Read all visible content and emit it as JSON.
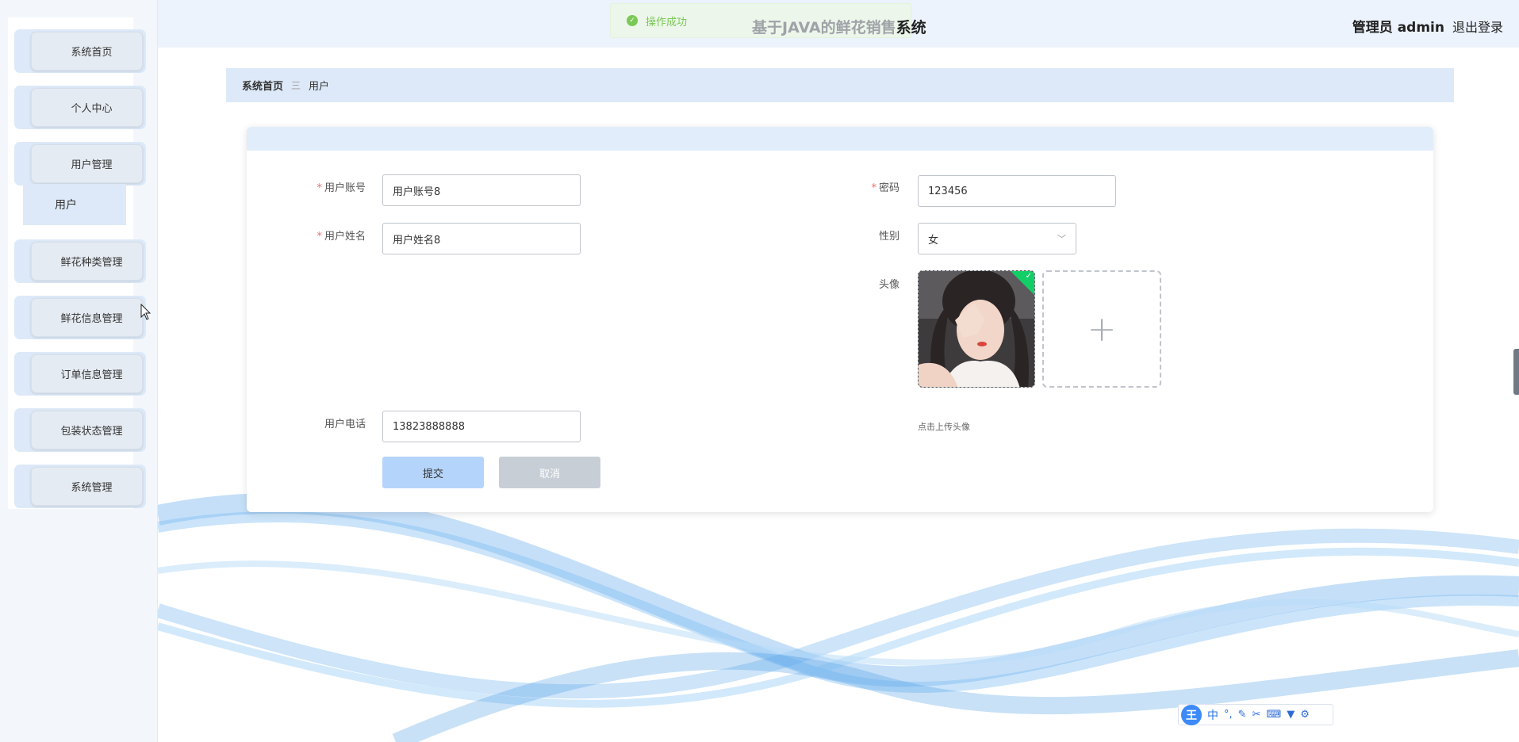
{
  "app": {
    "title_faded": "基于JAVA的鲜花销售",
    "title_visible": "系统"
  },
  "toast": {
    "message": "操作成功"
  },
  "user": {
    "role_name": "管理员 admin",
    "logout": "退出登录"
  },
  "sidebar": {
    "items": [
      {
        "label": "系统首页"
      },
      {
        "label": "个人中心"
      },
      {
        "label": "用户管理"
      },
      {
        "label": "鲜花种类管理"
      },
      {
        "label": "鲜花信息管理"
      },
      {
        "label": "订单信息管理"
      },
      {
        "label": "包装状态管理"
      },
      {
        "label": "系统管理"
      }
    ],
    "submenu": {
      "label": "用户"
    }
  },
  "breadcrumb": {
    "home": "系统首页",
    "separator": "三",
    "current": "用户"
  },
  "form": {
    "account": {
      "label": "用户账号",
      "value": "用户账号8"
    },
    "password": {
      "label": "密码",
      "value": "123456"
    },
    "name": {
      "label": "用户姓名",
      "value": "用户姓名8"
    },
    "gender": {
      "label": "性别",
      "value": "女"
    },
    "avatar": {
      "label": "头像",
      "tip": "点击上传头像"
    },
    "phone": {
      "label": "用户电话",
      "value": "13823888888"
    },
    "submit": "提交",
    "cancel": "取消"
  },
  "ime": {
    "logo": "王",
    "mode": "中",
    "punct": "°,"
  },
  "colors": {
    "accent_light": "#dde9f8",
    "header_bg": "#ecf3fc",
    "required": "#f56c6c",
    "success": "#67c23a",
    "upload_badge": "#13ce66"
  }
}
